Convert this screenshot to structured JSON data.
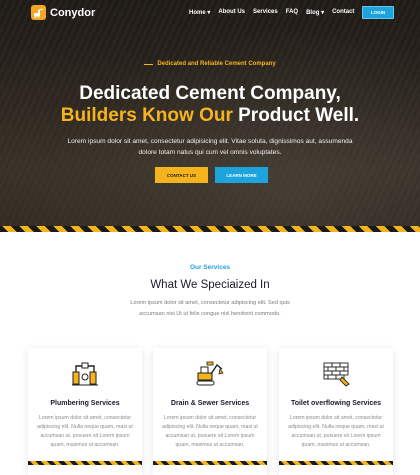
{
  "brand": {
    "name": "Conydor",
    "accent": "#f5b41e",
    "blue": "#1ea4dd"
  },
  "nav": {
    "items": [
      {
        "label": "Home ▾"
      },
      {
        "label": "About Us"
      },
      {
        "label": "Services"
      },
      {
        "label": "FAQ"
      },
      {
        "label": "Blog ▾"
      },
      {
        "label": "Contact"
      }
    ],
    "login_label": "LOGIN"
  },
  "hero": {
    "tagline": "Dedicated and Reliable Cement Company",
    "title_line1": "Dedicated Cement Company,",
    "title_highlight": "Builders Know Our",
    "title_rest": " Product Well.",
    "text": "Lorem ipsum dolor sit amet, consectetur adipisicing elit. Vitae soluta, dignissimos aut, assumenda dolore totam natus qui cum vel omnis voluptates.",
    "contact_label": "CONTACT US",
    "learn_label": "LEARN MORE"
  },
  "services": {
    "label": "Our Services",
    "title": "What We Speciaized In",
    "text": "Lorem ipsum dolor sit amet, consectetur adipiscing elit. Sed quis accumsan nisi Ut ut felis congue nisl hendrerit commodo.",
    "cards": [
      {
        "icon": "plumbering-icon",
        "title": "Plumbering Services",
        "text": "Lorem ipsum dolor sit amet, consectetur adipiscing elit. Nulla neque quam, maxi ut accumsan ut, posuere sit Lorem ipsum quam, maximus ut accumsan."
      },
      {
        "icon": "excavator-icon",
        "title": "Drain & Sewer Services",
        "text": "Lorem ipsum dolor sit amet, consectetur adipiscing elit. Nulla neque quam, maxi ut accumsan ut, posuere sit Lorem ipsum quam, maximus ut accumsan."
      },
      {
        "icon": "brick-wall-icon",
        "title": "Toilet overflowing Services",
        "text": "Lorem ipsum dolor sit amet, consectetur adipiscing elit. Nulla neque quam, maxi ut accumsan ut, posuere sit Lorem ipsum quam, maximus ut accumsan."
      }
    ]
  }
}
